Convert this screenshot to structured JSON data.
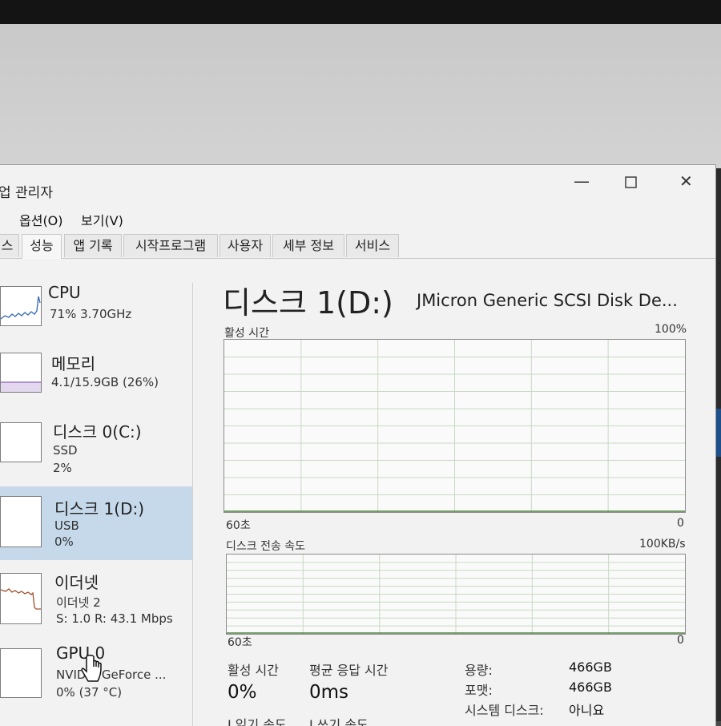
{
  "window": {
    "title": "업 관리자"
  },
  "menu": [
    {
      "label": "옵션(O)"
    },
    {
      "label": "보기(V)"
    }
  ],
  "tabs": [
    {
      "label": "스",
      "active": false
    },
    {
      "label": "성능",
      "active": true
    },
    {
      "label": "앱 기록",
      "active": false
    },
    {
      "label": "시작프로그램",
      "active": false
    },
    {
      "label": "사용자",
      "active": false
    },
    {
      "label": "세부 정보",
      "active": false
    },
    {
      "label": "서비스",
      "active": false
    }
  ],
  "sidebar": {
    "items": [
      {
        "name": "CPU",
        "line1": "71% 3.70GHz",
        "line2": "",
        "selected": false
      },
      {
        "name": "메모리",
        "line1": "4.1/15.9GB (26%)",
        "line2": "",
        "selected": false
      },
      {
        "name": "디스크 0(C:)",
        "line1": "SSD",
        "line2": "2%",
        "selected": false
      },
      {
        "name": "디스크 1(D:)",
        "line1": "USB",
        "line2": "0%",
        "selected": true
      },
      {
        "name": "이더넷",
        "line1": "이더넷 2",
        "line2": "S: 1.0 R: 43.1 Mbps",
        "selected": false
      },
      {
        "name": "GPU 0",
        "line1": "NVIDIA GeForce ...",
        "line2": "0% (37 °C)",
        "selected": false
      }
    ]
  },
  "detail": {
    "title": "디스크 1(D:)",
    "model": "JMicron Generic SCSI Disk De...",
    "graph1": {
      "label": "활성 시간",
      "max": "100%",
      "time": "60초",
      "min": "0",
      "value_percent": 0
    },
    "graph2": {
      "label": "디스크 전송 속도",
      "max": "100KB/s",
      "time": "60초",
      "min": "0",
      "value_percent": 0
    },
    "stats": {
      "active_label": "활성 시간",
      "active_value": "0%",
      "resp_label": "평균 응답 시간",
      "resp_value": "0ms",
      "read_label": "I 읽기 속도",
      "write_label": "I 쓰기 속도"
    },
    "properties": [
      {
        "key": "용량:",
        "value": "466GB"
      },
      {
        "key": "포맷:",
        "value": "466GB"
      },
      {
        "key": "시스템 디스크:",
        "value": "아니요"
      }
    ]
  },
  "colors": {
    "selected_bg": "#c5d9ea",
    "graph_line": "#4d7f3c",
    "graph_grid": "#c8d9c4"
  }
}
